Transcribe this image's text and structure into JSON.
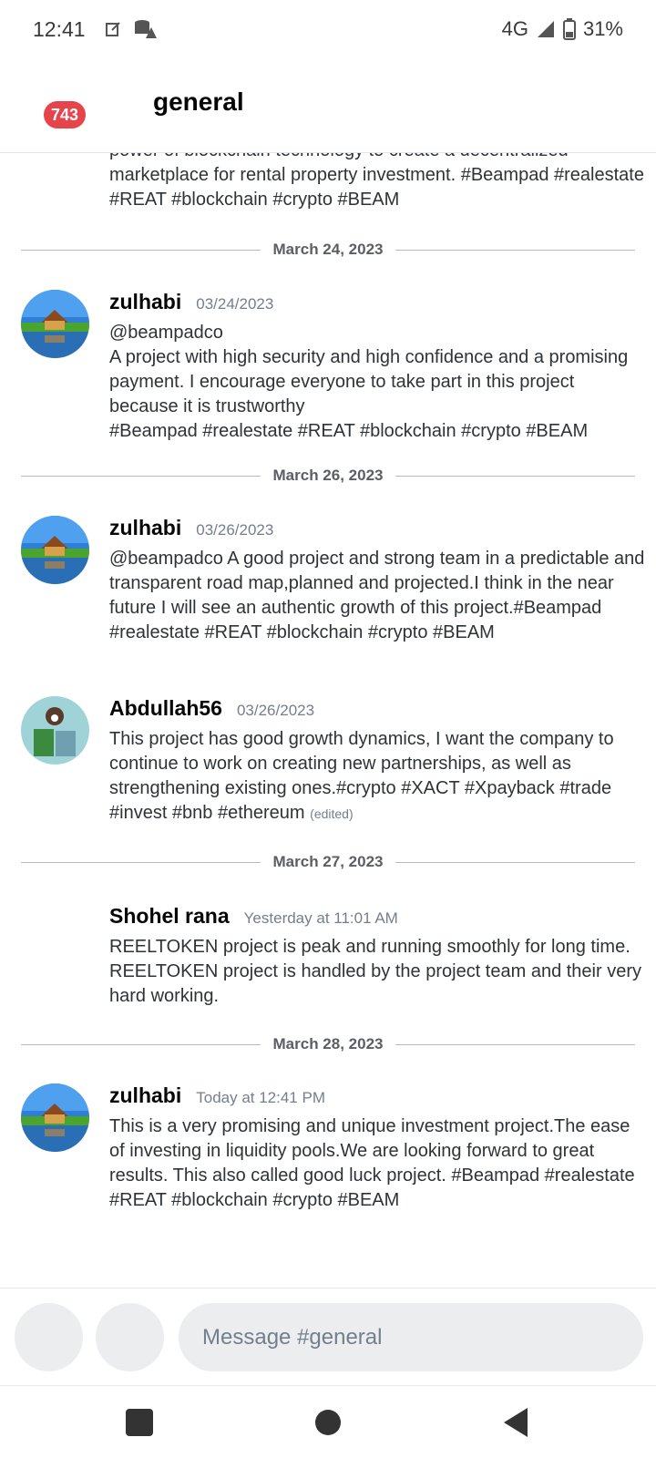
{
  "status_bar": {
    "time": "12:41",
    "network": "4G",
    "battery": "31%",
    "icons": [
      "note-icon",
      "storage-alert-icon",
      "signal-icon",
      "battery-icon"
    ]
  },
  "header": {
    "badge_count": "743",
    "channel_name": "general"
  },
  "messages": {
    "partial_text": "power of blockchain technology to create a decentralized marketplace for rental property investment. #Beampad #realestate #REAT #blockchain #crypto #BEAM",
    "dividers": [
      "March 24, 2023",
      "March 26, 2023",
      "March 27, 2023",
      "March 28, 2023"
    ],
    "items": [
      {
        "author": "zulhabi",
        "timestamp": "03/24/2023",
        "text": "@beampadco\nA project with high security and high confidence and a promising payment. I encourage everyone to take part in this project because it is trustworthy\n #Beampad #realestate #REAT #blockchain #crypto #BEAM"
      },
      {
        "author": "zulhabi",
        "timestamp": "03/26/2023",
        "text": "@beampadco A good project and strong team in a predictable and transparent road map,planned and projected.I think in the near future I will see an authentic growth of this project.#Beampad #realestate #REAT #blockchain #crypto #BEAM"
      },
      {
        "author": "Abdullah56",
        "timestamp": "03/26/2023",
        "text": "This project has good growth dynamics, I want the company to continue to work on creating new partnerships, as well as strengthening existing ones.#crypto #XACT #Xpayback #trade #invest #bnb #ethereum",
        "edited": "(edited)"
      },
      {
        "author": "Shohel rana",
        "timestamp": "Yesterday at 11:01 AM",
        "text": "REELTOKEN project is peak and running smoothly for long time. REELTOKEN project is handled by the project team and their very hard working."
      },
      {
        "author": "zulhabi",
        "timestamp": "Today at 12:41 PM",
        "text": "This is a very promising and unique investment project.The ease of investing in liquidity pools.We are looking forward to great results. This also called  good luck project. #Beampad #realestate #REAT #blockchain #crypto #BEAM"
      }
    ]
  },
  "composer": {
    "placeholder": "Message #general"
  },
  "colors": {
    "badge": "#e7434a",
    "timestamp": "#747f8d",
    "input_bg": "#ebedef"
  }
}
